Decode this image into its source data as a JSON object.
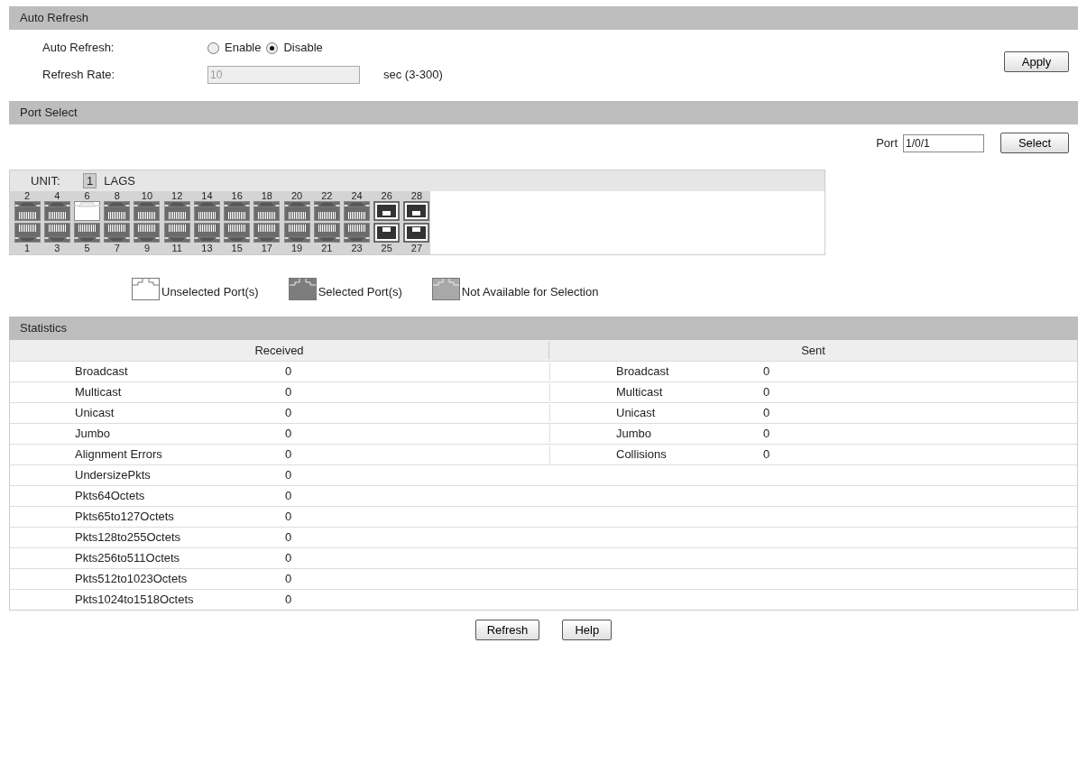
{
  "auto_refresh": {
    "title": "Auto Refresh",
    "label": "Auto Refresh:",
    "options": [
      {
        "label": "Enable",
        "selected": false
      },
      {
        "label": "Disable",
        "selected": true
      }
    ],
    "rate_label": "Refresh Rate:",
    "rate_value": "10",
    "rate_disabled": true,
    "rate_hint": "sec (3-300)",
    "apply": "Apply"
  },
  "port_select": {
    "title": "Port Select",
    "port_label": "Port",
    "port_value": "1/0/1",
    "select": "Select",
    "unit_label": "UNIT:",
    "unit_value": "1",
    "lags": "LAGS",
    "top_ports": [
      {
        "label": "2",
        "kind": "rj45",
        "selected": true
      },
      {
        "label": "4",
        "kind": "rj45",
        "selected": true
      },
      {
        "label": "6",
        "kind": "rj45",
        "selected": false
      },
      {
        "label": "8",
        "kind": "rj45",
        "selected": true
      },
      {
        "label": "10",
        "kind": "rj45",
        "selected": true
      },
      {
        "label": "12",
        "kind": "rj45",
        "selected": true
      },
      {
        "label": "14",
        "kind": "rj45",
        "selected": true
      },
      {
        "label": "16",
        "kind": "rj45",
        "selected": true
      },
      {
        "label": "18",
        "kind": "rj45",
        "selected": true
      },
      {
        "label": "20",
        "kind": "rj45",
        "selected": true
      },
      {
        "label": "22",
        "kind": "rj45",
        "selected": true
      },
      {
        "label": "24",
        "kind": "rj45",
        "selected": true
      },
      {
        "label": "26",
        "kind": "sfp",
        "selected": true
      },
      {
        "label": "28",
        "kind": "sfp",
        "selected": true
      }
    ],
    "bottom_ports": [
      {
        "label": "1",
        "kind": "rj45",
        "selected": true
      },
      {
        "label": "3",
        "kind": "rj45",
        "selected": true
      },
      {
        "label": "5",
        "kind": "rj45",
        "selected": true
      },
      {
        "label": "7",
        "kind": "rj45",
        "selected": true
      },
      {
        "label": "9",
        "kind": "rj45",
        "selected": true
      },
      {
        "label": "11",
        "kind": "rj45",
        "selected": true
      },
      {
        "label": "13",
        "kind": "rj45",
        "selected": true
      },
      {
        "label": "15",
        "kind": "rj45",
        "selected": true
      },
      {
        "label": "17",
        "kind": "rj45",
        "selected": true
      },
      {
        "label": "19",
        "kind": "rj45",
        "selected": true
      },
      {
        "label": "21",
        "kind": "rj45",
        "selected": true
      },
      {
        "label": "23",
        "kind": "rj45",
        "selected": true
      },
      {
        "label": "25",
        "kind": "sfp",
        "selected": true
      },
      {
        "label": "27",
        "kind": "sfp",
        "selected": true
      }
    ],
    "legend": [
      {
        "kind": "unselected",
        "label": "Unselected Port(s)"
      },
      {
        "kind": "selected",
        "label": "Selected Port(s)"
      },
      {
        "kind": "unavailable",
        "label": "Not Available for Selection"
      }
    ]
  },
  "statistics": {
    "title": "Statistics",
    "received": "Received",
    "sent": "Sent",
    "received_rows": [
      {
        "name": "Broadcast",
        "value": "0"
      },
      {
        "name": "Multicast",
        "value": "0"
      },
      {
        "name": "Unicast",
        "value": "0"
      },
      {
        "name": "Jumbo",
        "value": "0"
      },
      {
        "name": "Alignment Errors",
        "value": "0"
      },
      {
        "name": "UndersizePkts",
        "value": "0"
      },
      {
        "name": "Pkts64Octets",
        "value": "0"
      },
      {
        "name": "Pkts65to127Octets",
        "value": "0"
      },
      {
        "name": "Pkts128to255Octets",
        "value": "0"
      },
      {
        "name": "Pkts256to511Octets",
        "value": "0"
      },
      {
        "name": "Pkts512to1023Octets",
        "value": "0"
      },
      {
        "name": "Pkts1024to1518Octets",
        "value": "0"
      }
    ],
    "sent_rows": [
      {
        "name": "Broadcast",
        "value": "0"
      },
      {
        "name": "Multicast",
        "value": "0"
      },
      {
        "name": "Unicast",
        "value": "0"
      },
      {
        "name": "Jumbo",
        "value": "0"
      },
      {
        "name": "Collisions",
        "value": "0"
      }
    ]
  },
  "buttons": [
    "Refresh",
    "Help"
  ]
}
